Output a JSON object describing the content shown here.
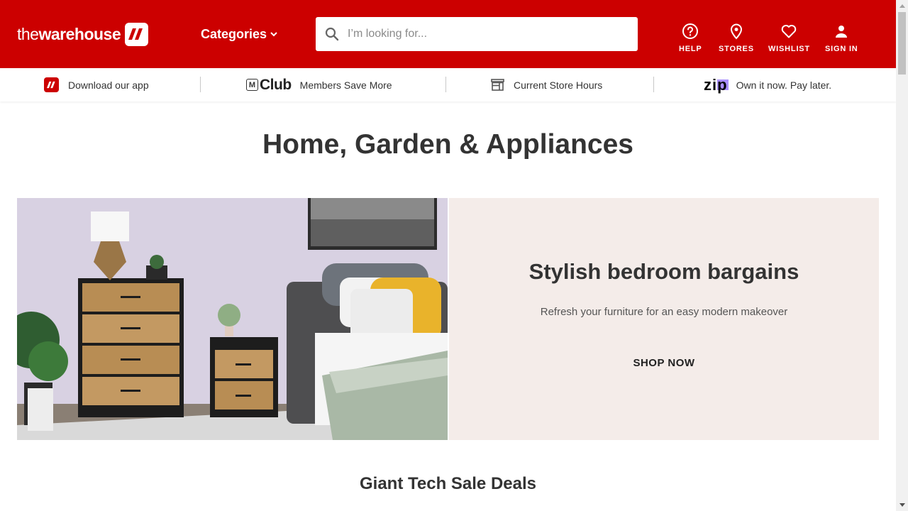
{
  "header": {
    "logo_prefix": "the",
    "logo_main": "warehouse",
    "categories_label": "Categories",
    "search_placeholder": "I’m looking for...",
    "nav": [
      {
        "label": "HELP",
        "icon": "help-circle-icon"
      },
      {
        "label": "STORES",
        "icon": "map-pin-icon"
      },
      {
        "label": "WISHLIST",
        "icon": "heart-icon"
      },
      {
        "label": "SIGN IN",
        "icon": "user-icon"
      }
    ],
    "brand_color": "#cc0000"
  },
  "infobar": {
    "items": [
      {
        "label": "Download our app",
        "icon": "app-logo-icon"
      },
      {
        "label": "Members Save More",
        "icon": "mclub-logo-icon",
        "logo_text": "Club"
      },
      {
        "label": "Current Store Hours",
        "icon": "store-icon"
      },
      {
        "label": "Own it now. Pay later.",
        "icon": "zip-logo-icon",
        "logo_text": "zip"
      }
    ]
  },
  "page": {
    "title": "Home, Garden & Appliances",
    "hero": {
      "title": "Stylish bedroom bargains",
      "subtitle": "Refresh your furniture for an easy modern makeover",
      "cta": "SHOP NOW",
      "panel_color": "#f4ece9"
    },
    "section_title": "Giant Tech Sale Deals"
  }
}
